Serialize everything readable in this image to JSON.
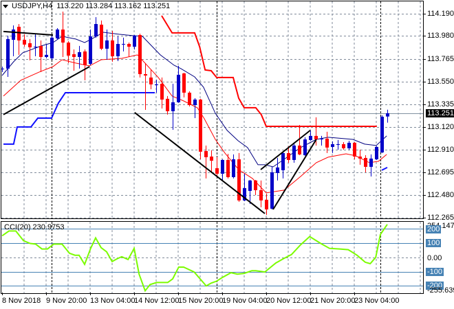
{
  "header": {
    "symbol": "USDJPY,H4",
    "ohlc": "113.220 113.284 113.162 113.251"
  },
  "cci_label": "CCI(20) 230.9753",
  "price_axis": [
    "114.190",
    "113.980",
    "113.765",
    "113.550",
    "113.335",
    "113.120",
    "112.910",
    "112.695",
    "112.480",
    "112.265"
  ],
  "current_price": "113.251",
  "cci_axis": {
    "max": "254.1475",
    "l200": "200",
    "l100": "100",
    "zero": "0.00",
    "lm100": "-100",
    "lm200": "-200",
    "min": "-255.6394"
  },
  "time_axis": [
    "8 Nov 2018",
    "9 Nov 20:00",
    "13 Nov 04:00",
    "14 Nov 12:00",
    "15 Nov 20:00",
    "19 Nov 04:00",
    "20 Nov 12:00",
    "21 Nov 20:00",
    "23 Nov 04:00"
  ],
  "colors": {
    "bull": "#0000c8",
    "bear": "#ff0000",
    "ma_slow": "#000080",
    "ma_fast": "#ff0000",
    "upper_band": "#ff0000",
    "lower_band": "#1010ff",
    "cci": "#7cfc00",
    "level": "#4682b4",
    "grid": "#7f8a99",
    "trend": "#000000"
  },
  "chart_data": [
    {
      "type": "candlestick",
      "title": "USDJPY,H4",
      "ylim": [
        112.265,
        114.19
      ],
      "candle_format": [
        "open",
        "high",
        "low",
        "close"
      ],
      "candles": [
        [
          113.672,
          113.691,
          113.64,
          113.672
        ],
        [
          113.672,
          113.983,
          113.594,
          113.951
        ],
        [
          113.944,
          114.08,
          113.789,
          114.041
        ],
        [
          114.067,
          114.093,
          113.802,
          113.938
        ],
        [
          113.944,
          113.996,
          113.879,
          113.899
        ],
        [
          113.912,
          113.951,
          113.75,
          113.873
        ],
        [
          113.873,
          113.996,
          113.789,
          113.879
        ],
        [
          113.886,
          113.938,
          113.64,
          113.782
        ],
        [
          113.782,
          113.899,
          113.769,
          113.802
        ],
        [
          113.769,
          113.996,
          113.756,
          113.964
        ],
        [
          113.957,
          114.054,
          113.944,
          114.041
        ],
        [
          114.041,
          114.21,
          113.782,
          113.918
        ],
        [
          113.918,
          113.931,
          113.724,
          113.795
        ],
        [
          113.808,
          113.853,
          113.652,
          113.782
        ],
        [
          113.782,
          113.886,
          113.672,
          113.827
        ],
        [
          113.834,
          113.853,
          113.562,
          113.704
        ],
        [
          113.717,
          114.041,
          113.704,
          113.976
        ],
        [
          113.976,
          114.158,
          113.964,
          114.093
        ],
        [
          114.087,
          114.126,
          113.847,
          113.86
        ],
        [
          113.86,
          114.041,
          113.756,
          113.938
        ],
        [
          113.938,
          114.028,
          113.737,
          113.789
        ],
        [
          113.789,
          113.976,
          113.743,
          113.905
        ],
        [
          113.899,
          113.964,
          113.834,
          113.905
        ],
        [
          113.905,
          113.918,
          113.782,
          113.879
        ],
        [
          113.879,
          113.989,
          113.853,
          113.983
        ],
        [
          113.989,
          114.002,
          113.588,
          113.62
        ],
        [
          113.62,
          113.724,
          113.283,
          113.607
        ],
        [
          113.588,
          113.665,
          113.477,
          113.523
        ],
        [
          113.516,
          113.568,
          113.445,
          113.523
        ],
        [
          113.529,
          113.588,
          113.296,
          113.38
        ],
        [
          113.387,
          113.413,
          113.238,
          113.27
        ],
        [
          113.27,
          113.529,
          113.095,
          113.354
        ],
        [
          113.354,
          113.698,
          113.348,
          113.614
        ],
        [
          113.627,
          113.633,
          113.4,
          113.445
        ],
        [
          113.445,
          113.458,
          113.315,
          113.328
        ],
        [
          113.328,
          113.393,
          113.205,
          113.38
        ],
        [
          113.38,
          113.387,
          112.816,
          112.888
        ],
        [
          112.894,
          112.946,
          112.635,
          112.836
        ],
        [
          112.842,
          112.901,
          112.687,
          112.803
        ],
        [
          112.732,
          112.836,
          112.654,
          112.68
        ],
        [
          112.68,
          112.816,
          112.622,
          112.81
        ],
        [
          112.81,
          112.868,
          112.635,
          112.648
        ],
        [
          112.648,
          112.862,
          112.635,
          112.816
        ],
        [
          112.816,
          112.875,
          112.415,
          112.428
        ],
        [
          112.428,
          112.68,
          112.421,
          112.544
        ],
        [
          112.518,
          112.622,
          112.395,
          112.616
        ],
        [
          112.616,
          112.622,
          112.479,
          112.525
        ],
        [
          112.525,
          112.616,
          112.363,
          112.428
        ],
        [
          112.434,
          112.492,
          112.291,
          112.343
        ],
        [
          112.35,
          112.745,
          112.343,
          112.693
        ],
        [
          112.687,
          112.829,
          112.616,
          112.739
        ],
        [
          112.713,
          112.894,
          112.635,
          112.875
        ],
        [
          112.875,
          112.94,
          112.784,
          112.81
        ],
        [
          112.81,
          112.972,
          112.784,
          112.946
        ],
        [
          112.946,
          113.14,
          112.855,
          112.862
        ],
        [
          112.855,
          113.024,
          112.849,
          113.004
        ],
        [
          112.998,
          113.089,
          112.991,
          113.037
        ],
        [
          113.037,
          113.212,
          112.946,
          113.004
        ],
        [
          113.004,
          113.037,
          112.946,
          113.011
        ],
        [
          113.011,
          113.076,
          112.875,
          112.927
        ],
        [
          112.933,
          112.985,
          112.875,
          112.959
        ],
        [
          112.952,
          112.998,
          112.907,
          112.959
        ],
        [
          112.959,
          112.978,
          112.907,
          112.92
        ],
        [
          112.92,
          112.991,
          112.907,
          112.972
        ],
        [
          112.972,
          112.978,
          112.816,
          112.842
        ],
        [
          112.842,
          112.907,
          112.765,
          112.823
        ],
        [
          112.829,
          112.855,
          112.693,
          112.745
        ],
        [
          112.745,
          112.862,
          112.654,
          112.823
        ],
        [
          112.816,
          112.94,
          112.81,
          112.933
        ],
        [
          112.881,
          113.231,
          112.875,
          113.218
        ],
        [
          113.22,
          113.284,
          113.162,
          113.251
        ]
      ],
      "lines": {
        "ma_slow": [
          [
            0,
            113.607
          ],
          [
            2.1,
            113.737
          ],
          [
            3.75,
            113.821
          ],
          [
            7.1,
            113.886
          ],
          [
            9.25,
            113.918
          ],
          [
            10.9,
            113.977
          ],
          [
            13.4,
            113.951
          ],
          [
            15,
            113.918
          ],
          [
            16.25,
            113.951
          ],
          [
            18.4,
            114.015
          ],
          [
            21.25,
            113.996
          ],
          [
            23.75,
            113.983
          ],
          [
            25.5,
            113.977
          ],
          [
            28.75,
            113.802
          ],
          [
            31.25,
            113.704
          ],
          [
            32.5,
            113.672
          ],
          [
            35,
            113.594
          ],
          [
            36.6,
            113.497
          ],
          [
            38.75,
            113.251
          ],
          [
            40.9,
            113.089
          ],
          [
            42.9,
            112.991
          ],
          [
            44.6,
            112.927
          ],
          [
            46.5,
            112.765
          ],
          [
            47.75,
            112.765
          ],
          [
            49.25,
            112.745
          ],
          [
            51.25,
            112.816
          ],
          [
            54.25,
            112.927
          ],
          [
            57.1,
            113.004
          ],
          [
            59.25,
            113.024
          ],
          [
            63.75,
            113.004
          ],
          [
            65.9,
            112.959
          ],
          [
            68,
            112.946
          ],
          [
            69.9,
            113.037
          ]
        ],
        "ma_fast": [
          [
            0.25,
            113.413
          ],
          [
            3.4,
            113.562
          ],
          [
            6.75,
            113.64
          ],
          [
            9.25,
            113.691
          ],
          [
            10.9,
            113.756
          ],
          [
            13.4,
            113.724
          ],
          [
            15.9,
            113.698
          ],
          [
            18,
            113.756
          ],
          [
            21.75,
            113.769
          ],
          [
            24.6,
            113.802
          ],
          [
            28.4,
            113.588
          ],
          [
            30.9,
            113.413
          ],
          [
            33,
            113.367
          ],
          [
            35.5,
            113.302
          ],
          [
            36.75,
            113.199
          ],
          [
            38.75,
            113.004
          ],
          [
            40.5,
            112.875
          ],
          [
            43,
            112.719
          ],
          [
            45.5,
            112.635
          ],
          [
            48,
            112.499
          ],
          [
            51.25,
            112.525
          ],
          [
            54.25,
            112.654
          ],
          [
            57.1,
            112.784
          ],
          [
            59.25,
            112.836
          ],
          [
            62.5,
            112.868
          ],
          [
            64.25,
            112.849
          ],
          [
            66.75,
            112.784
          ],
          [
            68.4,
            112.797
          ],
          [
            69.9,
            112.862
          ]
        ],
        "upper_band": [
          [
            29,
            114.171
          ],
          [
            30.9,
            114.009
          ],
          [
            35,
            114.009
          ],
          [
            35.9,
            113.879
          ],
          [
            36.9,
            113.659
          ],
          [
            38,
            113.652
          ],
          [
            39,
            113.588
          ],
          [
            42,
            113.588
          ],
          [
            43,
            113.393
          ],
          [
            44,
            113.303
          ],
          [
            46.1,
            113.303
          ],
          [
            47.1,
            113.238
          ],
          [
            48,
            113.127
          ],
          [
            68.1,
            113.127
          ]
        ],
        "lower_band": [
          [
            0.25,
            112.959
          ],
          [
            2.1,
            112.959
          ],
          [
            2.75,
            113.121
          ],
          [
            5.25,
            113.121
          ],
          [
            6.5,
            113.205
          ],
          [
            9,
            113.205
          ],
          [
            10.25,
            113.348
          ],
          [
            11.5,
            113.445
          ],
          [
            27.75,
            113.445
          ]
        ],
        "lower_band_end": [
          [
            69,
            112.713
          ],
          [
            70,
            112.739
          ]
        ]
      },
      "trendlines": [
        [
          [
            0.25,
            114.022
          ],
          [
            9.25,
            113.989
          ]
        ],
        [
          [
            0.25,
            113.238
          ],
          [
            15.9,
            113.691
          ]
        ],
        [
          [
            24.1,
            113.257
          ],
          [
            47.75,
            112.304
          ]
        ],
        [
          [
            47,
            112.719
          ],
          [
            56,
            113.089
          ]
        ],
        [
          [
            49.25,
            112.343
          ],
          [
            57.1,
            113.004
          ]
        ]
      ],
      "current_price": 113.251,
      "period_separators": [
        9,
        39,
        68.75
      ]
    },
    {
      "type": "line",
      "title": "CCI(20)",
      "ylim": [
        -255.6394,
        254.1475
      ],
      "levels": [
        200,
        100,
        -100,
        -200
      ],
      "zero": 0,
      "points": [
        [
          0,
          151
        ],
        [
          1.25,
          185
        ],
        [
          2.5,
          185
        ],
        [
          3.9,
          117
        ],
        [
          5.1,
          98
        ],
        [
          6.1,
          93
        ],
        [
          7.25,
          59
        ],
        [
          8.25,
          59
        ],
        [
          9.4,
          93
        ],
        [
          10.9,
          93
        ],
        [
          12.25,
          29
        ],
        [
          13.25,
          15
        ],
        [
          14,
          15
        ],
        [
          15,
          -49
        ],
        [
          16.1,
          63
        ],
        [
          17,
          137
        ],
        [
          18,
          68
        ],
        [
          19,
          39
        ],
        [
          20,
          -29
        ],
        [
          20.9,
          -10
        ],
        [
          21.75,
          5
        ],
        [
          22.9,
          -15
        ],
        [
          24,
          63
        ],
        [
          24.9,
          -117
        ],
        [
          26,
          -234
        ],
        [
          26.9,
          -190
        ],
        [
          28.1,
          -176
        ],
        [
          30.1,
          -176
        ],
        [
          31,
          -151
        ],
        [
          32.1,
          -68
        ],
        [
          33,
          -68
        ],
        [
          34.9,
          -102
        ],
        [
          37.1,
          -200
        ],
        [
          38,
          -180
        ],
        [
          39,
          -166
        ],
        [
          40,
          -141
        ],
        [
          41.6,
          -107
        ],
        [
          42.75,
          -117
        ],
        [
          44,
          -112
        ],
        [
          45.4,
          -93
        ],
        [
          46.1,
          -93
        ],
        [
          47.75,
          -102
        ],
        [
          49.75,
          -39
        ],
        [
          51.1,
          -10
        ],
        [
          52.6,
          20
        ],
        [
          54.25,
          88
        ],
        [
          55.9,
          146
        ],
        [
          57.9,
          98
        ],
        [
          59.5,
          63
        ],
        [
          61.4,
          59
        ],
        [
          62.9,
          54
        ],
        [
          64.5,
          15
        ],
        [
          66,
          -34
        ],
        [
          66.9,
          -44
        ],
        [
          67.9,
          0
        ],
        [
          68.75,
          161
        ],
        [
          70,
          230.9753
        ]
      ]
    }
  ]
}
